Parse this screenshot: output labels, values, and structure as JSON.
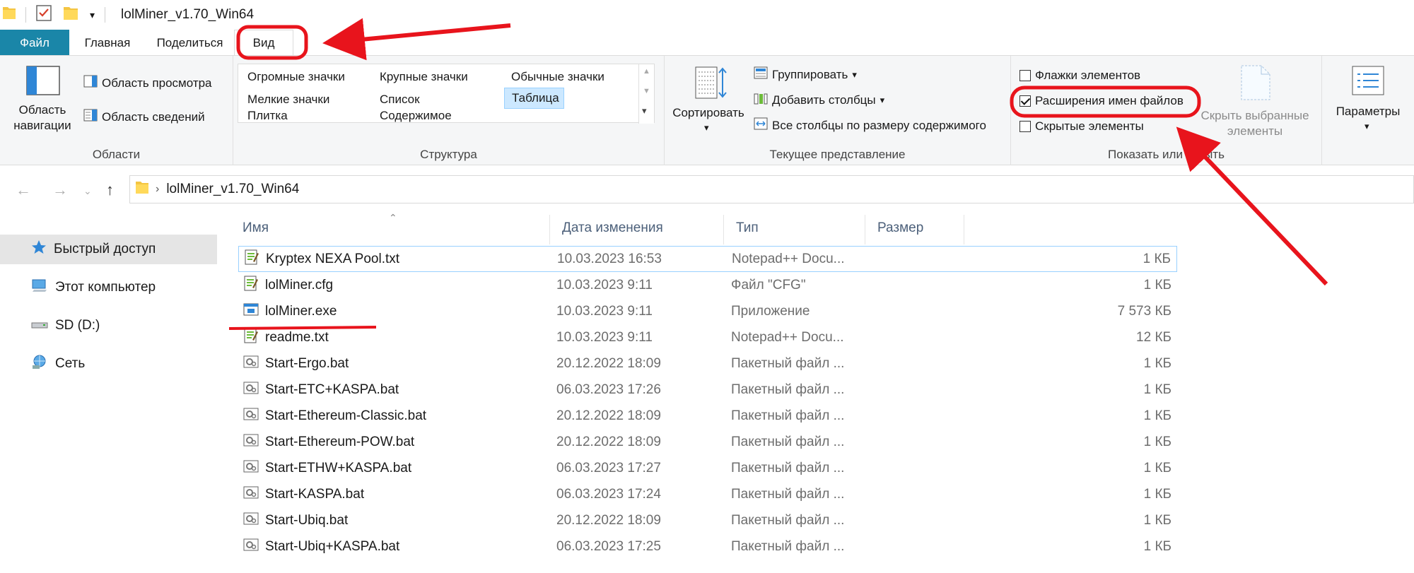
{
  "window": {
    "title": "lolMiner_v1.70_Win64"
  },
  "tabs": {
    "file": "Файл",
    "home": "Главная",
    "share": "Поделиться",
    "view": "Вид"
  },
  "ribbon": {
    "panes": {
      "label": "Области",
      "nav_pane": "Область\nнавигации",
      "preview_pane": "Область просмотра",
      "details_pane": "Область сведений"
    },
    "layout": {
      "label": "Структура",
      "items": [
        "Огромные значки",
        "Крупные значки",
        "Обычные значки",
        "Мелкие значки",
        "Список",
        "Таблица",
        "Плитка",
        "Содержимое"
      ],
      "selected": "Таблица"
    },
    "current_view": {
      "label": "Текущее представление",
      "sort_by": "Сортировать",
      "group_by": "Группировать",
      "add_columns": "Добавить столбцы",
      "size_columns": "Все столбцы по размеру содержимого"
    },
    "show_hide": {
      "label": "Показать или скрыть",
      "item_checkboxes": "Флажки элементов",
      "item_checkboxes_checked": false,
      "file_extensions": "Расширения имен файлов",
      "file_extensions_checked": true,
      "hidden_items": "Скрытые элементы",
      "hidden_items_checked": false,
      "hide_selected": "Скрыть выбранные\nэлементы"
    },
    "options": {
      "label": "Параметры"
    }
  },
  "address": {
    "path": "lolMiner_v1.70_Win64"
  },
  "nav_pane": {
    "items": [
      {
        "label": "Быстрый доступ",
        "icon": "star-icon"
      },
      {
        "label": "Этот компьютер",
        "icon": "computer-icon"
      },
      {
        "label": "SD (D:)",
        "icon": "drive-icon"
      },
      {
        "label": "Сеть",
        "icon": "network-icon"
      }
    ]
  },
  "columns": {
    "name": "Имя",
    "date": "Дата изменения",
    "type": "Тип",
    "size": "Размер"
  },
  "files": [
    {
      "name": "Kryptex NEXA Pool.txt",
      "date": "10.03.2023 16:53",
      "type": "Notepad++ Docu...",
      "size": "1 КБ",
      "icon": "notepad-icon"
    },
    {
      "name": "lolMiner.cfg",
      "date": "10.03.2023 9:11",
      "type": "Файл \"CFG\"",
      "size": "1 КБ",
      "icon": "notepad-icon"
    },
    {
      "name": "lolMiner.exe",
      "date": "10.03.2023 9:11",
      "type": "Приложение",
      "size": "7 573 КБ",
      "icon": "app-icon"
    },
    {
      "name": "readme.txt",
      "date": "10.03.2023 9:11",
      "type": "Notepad++ Docu...",
      "size": "12 КБ",
      "icon": "notepad-icon"
    },
    {
      "name": "Start-Ergo.bat",
      "date": "20.12.2022 18:09",
      "type": "Пакетный файл ...",
      "size": "1 КБ",
      "icon": "batch-icon"
    },
    {
      "name": "Start-ETC+KASPA.bat",
      "date": "06.03.2023 17:26",
      "type": "Пакетный файл ...",
      "size": "1 КБ",
      "icon": "batch-icon"
    },
    {
      "name": "Start-Ethereum-Classic.bat",
      "date": "20.12.2022 18:09",
      "type": "Пакетный файл ...",
      "size": "1 КБ",
      "icon": "batch-icon"
    },
    {
      "name": "Start-Ethereum-POW.bat",
      "date": "20.12.2022 18:09",
      "type": "Пакетный файл ...",
      "size": "1 КБ",
      "icon": "batch-icon"
    },
    {
      "name": "Start-ETHW+KASPA.bat",
      "date": "06.03.2023 17:27",
      "type": "Пакетный файл ...",
      "size": "1 КБ",
      "icon": "batch-icon"
    },
    {
      "name": "Start-KASPA.bat",
      "date": "06.03.2023 17:24",
      "type": "Пакетный файл ...",
      "size": "1 КБ",
      "icon": "batch-icon"
    },
    {
      "name": "Start-Ubiq.bat",
      "date": "20.12.2022 18:09",
      "type": "Пакетный файл ...",
      "size": "1 КБ",
      "icon": "batch-icon"
    },
    {
      "name": "Start-Ubiq+KASPA.bat",
      "date": "06.03.2023 17:25",
      "type": "Пакетный файл ...",
      "size": "1 КБ",
      "icon": "batch-icon"
    }
  ],
  "colors": {
    "accent": "#1a86a8",
    "annotation": "#e8141c",
    "selection": "#cce8ff"
  }
}
